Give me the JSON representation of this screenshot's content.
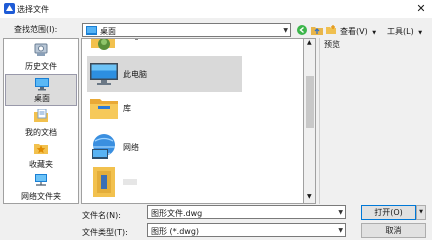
{
  "title": "选择文件",
  "lookin": {
    "label": "查找范围(I):",
    "value": "桌面"
  },
  "toolbar": {
    "views": "查看(V)",
    "tools": "工具(L)"
  },
  "preview_label": "预览",
  "sidebar": {
    "items": [
      {
        "label": "历史文件",
        "icon": "history-icon"
      },
      {
        "label": "桌面",
        "icon": "desktop-icon"
      },
      {
        "label": "我的文档",
        "icon": "documents-icon"
      },
      {
        "label": "收藏夹",
        "icon": "favorites-icon"
      },
      {
        "label": "网络文件夹",
        "icon": "network-folder-icon"
      }
    ]
  },
  "files": [
    {
      "name": "此电脑",
      "icon": "computer-icon"
    },
    {
      "name": "库",
      "icon": "library-folder-icon"
    },
    {
      "name": "网络",
      "icon": "network-icon"
    }
  ],
  "filename": {
    "label": "文件名(N):",
    "value": "图形文件.dwg"
  },
  "filetype": {
    "label": "文件类型(T):",
    "value": "图形 (*.dwg)"
  },
  "buttons": {
    "open": "打开(O)",
    "cancel": "取消"
  },
  "colors": {
    "selection": "#d9d9d9",
    "accent": "#0078d7"
  }
}
